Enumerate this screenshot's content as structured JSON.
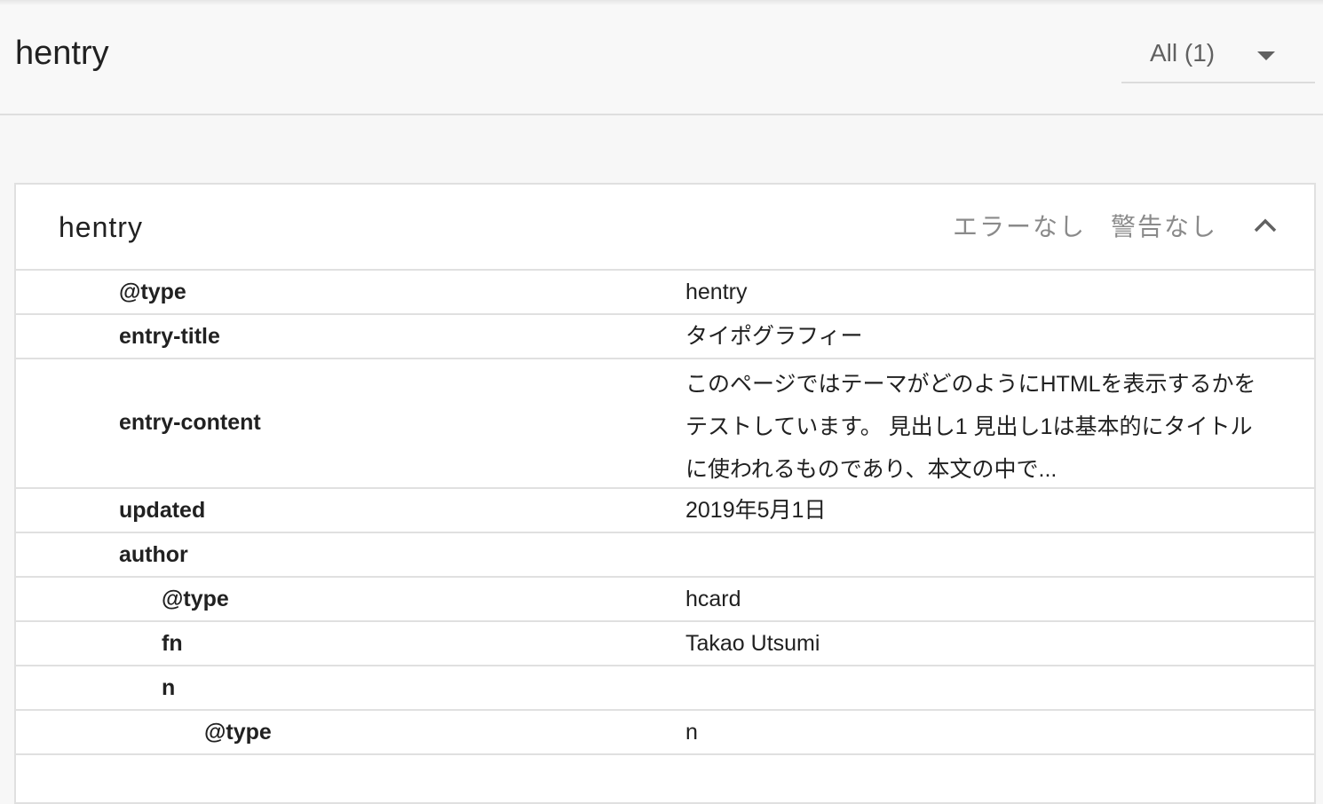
{
  "header": {
    "title": "hentry",
    "filter": {
      "selected": "All (1)",
      "icon": "dropdown-arrow-icon"
    }
  },
  "card": {
    "title": "hentry",
    "errors": "エラーなし",
    "warnings": "警告なし",
    "collapse_icon": "chevron-up-icon",
    "rows": [
      {
        "key": "@type",
        "value": "hentry",
        "indent": 0
      },
      {
        "key": "entry-title",
        "value": "タイポグラフィー",
        "indent": 0
      },
      {
        "key": "entry-content",
        "value": "このページではテーマがどのようにHTMLを表示するかをテストしています。 見出し1 見出し1は基本的にタイトルに使われるものであり、本文の中で...",
        "indent": 0
      },
      {
        "key": "updated",
        "value": "2019年5月1日",
        "indent": 0
      },
      {
        "key": "author",
        "value": "",
        "indent": 0
      },
      {
        "key": "@type",
        "value": "hcard",
        "indent": 1
      },
      {
        "key": "fn",
        "value": "Takao Utsumi",
        "indent": 1
      },
      {
        "key": "n",
        "value": "",
        "indent": 1
      },
      {
        "key": "@type",
        "value": "n",
        "indent": 2
      }
    ]
  }
}
